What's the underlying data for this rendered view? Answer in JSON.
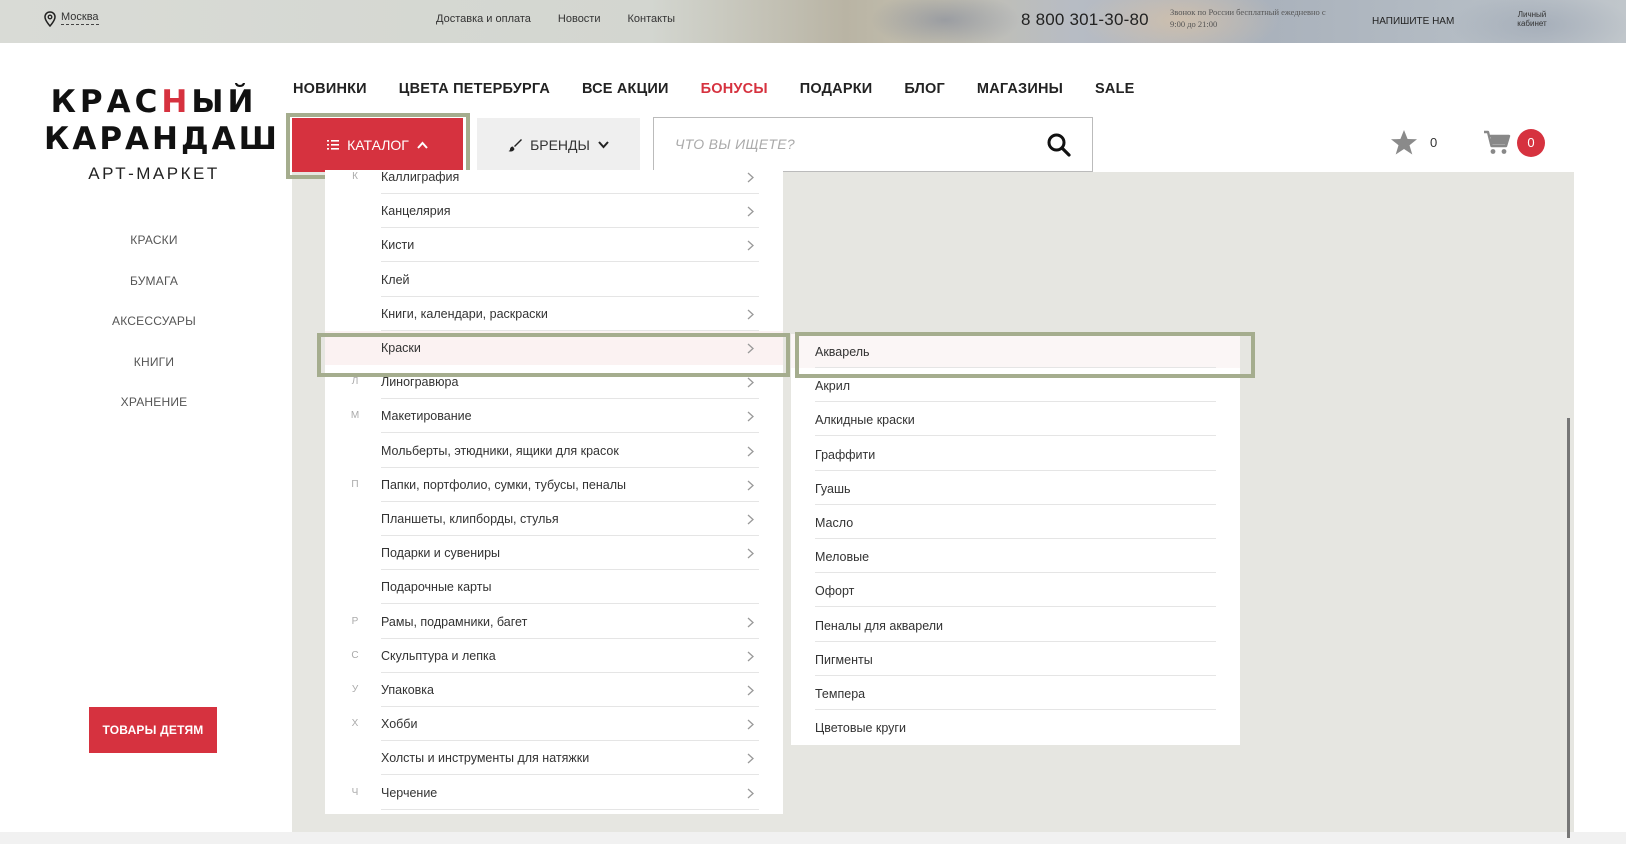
{
  "topbar": {
    "city": "Москва",
    "links": [
      "Доставка и оплата",
      "Новости",
      "Контакты"
    ],
    "phone": "8 800 301-30-80",
    "call_note": "Звонок по России бесплатный ежедневно с 9:00 до 21:00",
    "write_us": "НАПИШИТЕ НАМ",
    "cabinet": "Личный кабинет"
  },
  "logo": {
    "line1_a": "КРАС",
    "line1_b": "Н",
    "line1_c": "ЫЙ",
    "line2": "КАРАНДАШ",
    "line3": "АРТ-МАРКЕТ"
  },
  "sidenav": [
    "КРАСКИ",
    "БУМАГА",
    "АКСЕССУАРЫ",
    "КНИГИ",
    "ХРАНЕНИЕ"
  ],
  "kids_button": "ТОВАРЫ ДЕТЯМ",
  "mainnav": [
    "НОВИНКИ",
    "ЦВЕТА ПЕТЕРБУРГА",
    "ВСЕ АКЦИИ",
    "БОНУСЫ",
    "ПОДАРКИ",
    "БЛОГ",
    "МАГАЗИНЫ",
    "SALE"
  ],
  "catalog_label": "КАТАЛОГ",
  "brands_label": "БРЕНДЫ",
  "search": {
    "placeholder": "ЧТО ВЫ ИЩЕТЕ?",
    "value": ""
  },
  "favorites_count": "0",
  "cart_count": "0",
  "accent_color": "#d6323f",
  "highlight_color": "#a5ad8e",
  "categories": [
    {
      "letter": "К",
      "label": "Каллиграфия",
      "chevron": true
    },
    {
      "letter": "",
      "label": "Канцелярия",
      "chevron": true
    },
    {
      "letter": "",
      "label": "Кисти",
      "chevron": true
    },
    {
      "letter": "",
      "label": "Клей",
      "chevron": false
    },
    {
      "letter": "",
      "label": "Книги, календари, раскраски",
      "chevron": true
    },
    {
      "letter": "",
      "label": "Краски",
      "chevron": true,
      "active": true
    },
    {
      "letter": "Л",
      "label": "Линогравюра",
      "chevron": true
    },
    {
      "letter": "М",
      "label": "Макетирование",
      "chevron": true
    },
    {
      "letter": "",
      "label": "Мольберты, этюдники, ящики для красок",
      "chevron": true
    },
    {
      "letter": "П",
      "label": "Папки, портфолио, сумки, тубусы, пеналы",
      "chevron": true
    },
    {
      "letter": "",
      "label": "Планшеты, клипборды, стулья",
      "chevron": true
    },
    {
      "letter": "",
      "label": "Подарки и сувениры",
      "chevron": true
    },
    {
      "letter": "",
      "label": "Подарочные карты",
      "chevron": false
    },
    {
      "letter": "Р",
      "label": "Рамы, подрамники, багет",
      "chevron": true
    },
    {
      "letter": "С",
      "label": "Скульптура и лепка",
      "chevron": true
    },
    {
      "letter": "У",
      "label": "Упаковка",
      "chevron": true
    },
    {
      "letter": "Х",
      "label": "Хобби",
      "chevron": true
    },
    {
      "letter": "",
      "label": "Холсты и инструменты для натяжки",
      "chevron": true
    },
    {
      "letter": "Ч",
      "label": "Черчение",
      "chevron": true
    }
  ],
  "subcategories": [
    {
      "label": "Акварель",
      "active": true
    },
    {
      "label": "Акрил"
    },
    {
      "label": "Алкидные краски"
    },
    {
      "label": "Граффити"
    },
    {
      "label": "Гуашь"
    },
    {
      "label": "Масло"
    },
    {
      "label": "Меловые"
    },
    {
      "label": "Офорт"
    },
    {
      "label": "Пеналы для акварели"
    },
    {
      "label": "Пигменты"
    },
    {
      "label": "Темпера"
    },
    {
      "label": "Цветовые круги"
    }
  ]
}
